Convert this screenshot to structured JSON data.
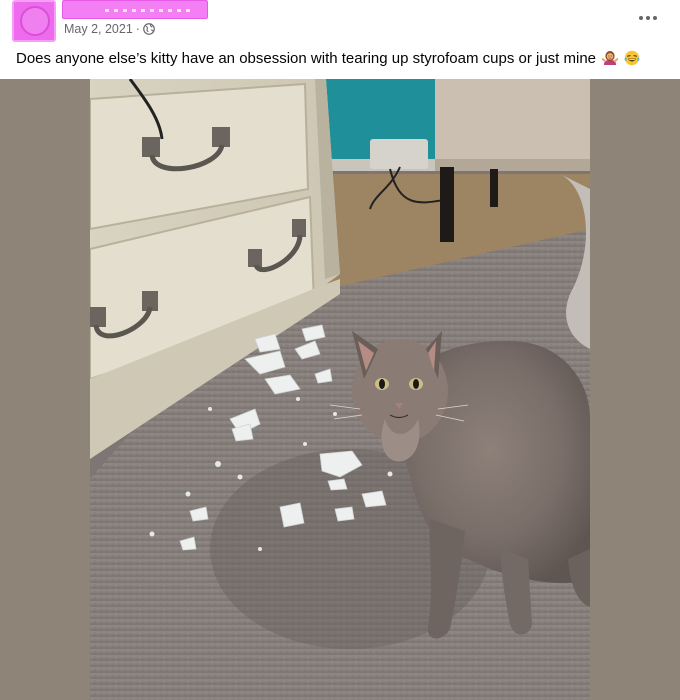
{
  "post": {
    "date": "May 2, 2021",
    "separator": "·",
    "caption": "Does anyone else’s kitty have an obsession with tearing up styrofoam cups or just mine",
    "emojis": [
      "woman-shrugging-emoji",
      "laughing-tears-emoji"
    ]
  },
  "icons": {
    "privacy": "globe-icon",
    "more": "more-dots-icon"
  },
  "colors": {
    "redaction": "#f47ef4",
    "meta_text": "#65676b",
    "photo_backdrop": "#8f8478"
  }
}
